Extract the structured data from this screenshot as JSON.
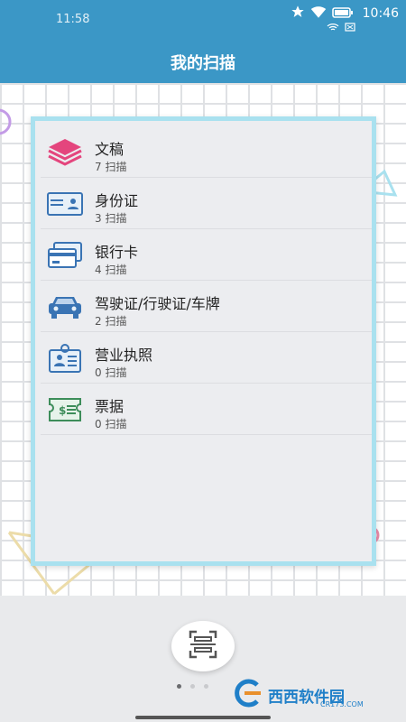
{
  "status_bar": {
    "left_time": "11:58",
    "right_time": "10:46",
    "icons": [
      "star-icon",
      "wifi-icon",
      "sim-icon",
      "battery-icon"
    ]
  },
  "app_bar": {
    "title": "我的扫描"
  },
  "scan_list": [
    {
      "label": "文稿",
      "count": "7 扫描",
      "icon": "documents-stack-icon"
    },
    {
      "label": "身份证",
      "count": "3 扫描",
      "icon": "id-card-icon"
    },
    {
      "label": "银行卡",
      "count": "4 扫描",
      "icon": "bank-card-icon"
    },
    {
      "label": "驾驶证/行驶证/车牌",
      "count": "2 扫描",
      "icon": "car-icon"
    },
    {
      "label": "营业执照",
      "count": "0 扫描",
      "icon": "business-license-icon"
    },
    {
      "label": "票据",
      "count": "0 扫描",
      "icon": "bill-icon"
    }
  ],
  "bottom": {
    "scan_button_icon": "scan-icon",
    "pager_pages": 3,
    "pager_active": 0
  },
  "watermark": {
    "text": "西西软件园",
    "sub": "CR173.COM"
  },
  "colors": {
    "app_bar": "#3b97c6",
    "card_border": "#a9e1ef",
    "accent_pink": "#e86aa0",
    "accent_purple": "#c39be6"
  }
}
